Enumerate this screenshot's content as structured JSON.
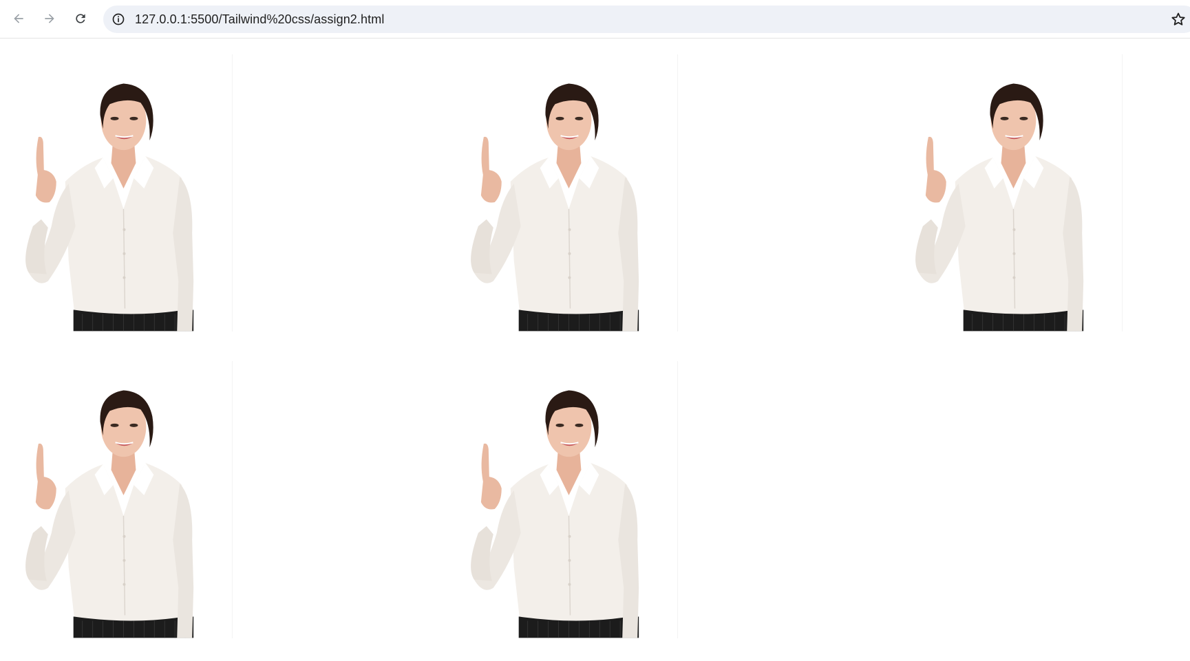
{
  "browser": {
    "url": "127.0.0.1:5500/Tailwind%20css/assign2.html",
    "back_icon": "arrow-left-icon",
    "forward_icon": "arrow-right-icon",
    "reload_icon": "reload-icon",
    "site_info_icon": "info-icon",
    "bookmark_icon": "star-icon"
  },
  "gallery": {
    "image_count": 5,
    "image_subject": "woman-pointing-up-photo"
  },
  "colors": {
    "toolbar_bg": "#ffffff",
    "omnibox_bg": "#eef1f7",
    "page_bg": "#ffffff",
    "icon": "#5f6368"
  }
}
